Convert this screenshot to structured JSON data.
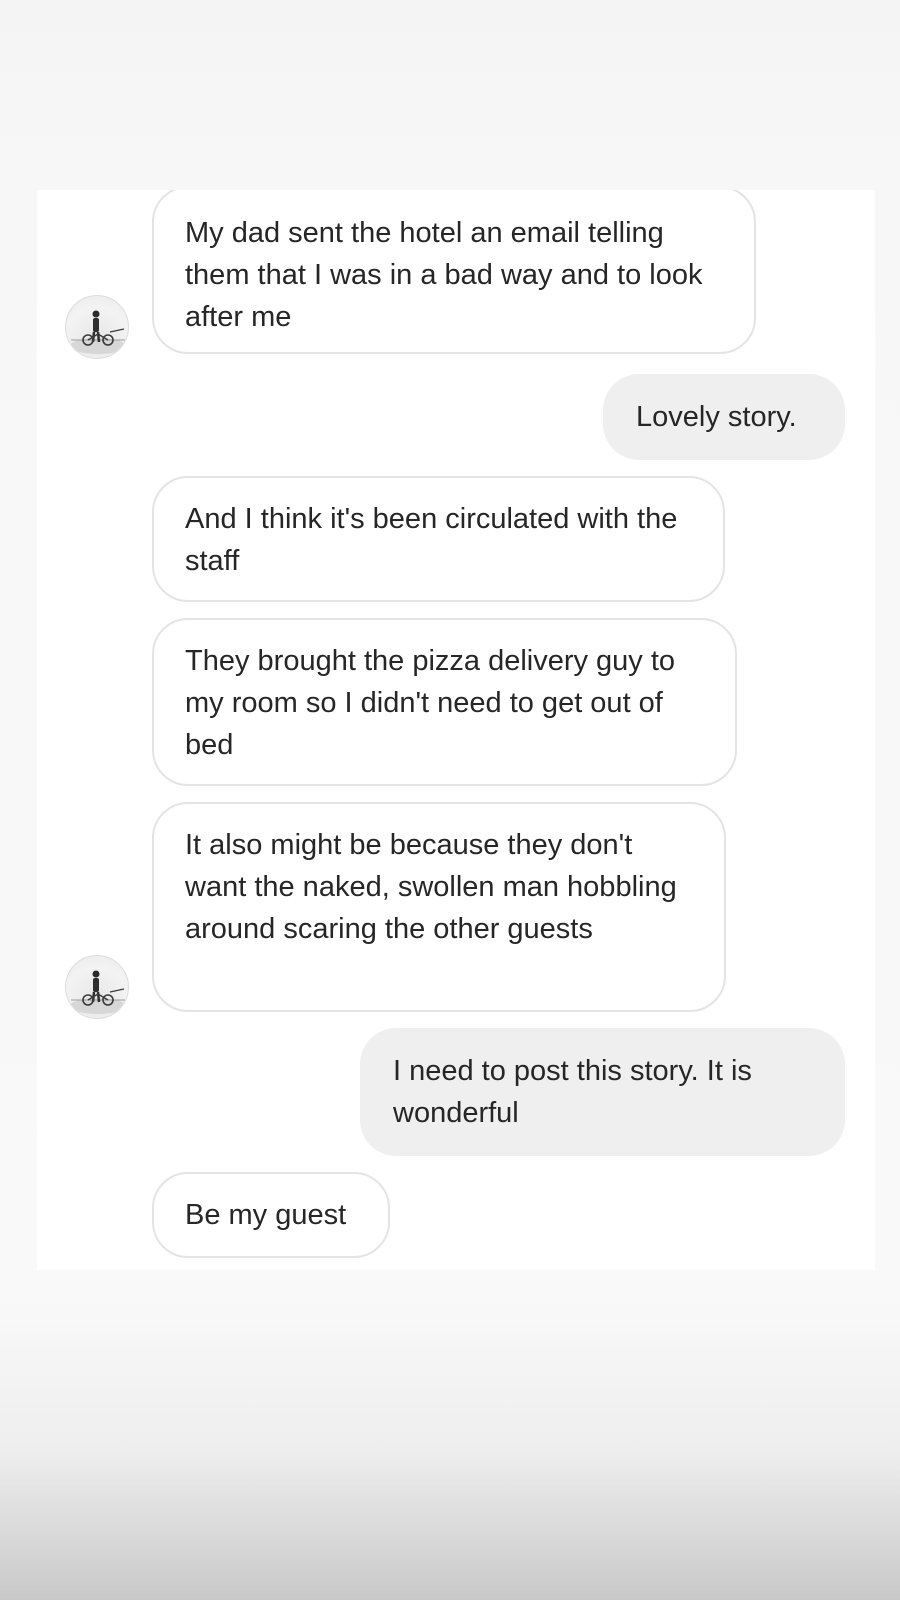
{
  "conversation": {
    "contact_avatar_icon": "profile-photo-person-with-bicycle-icon",
    "messages": [
      {
        "direction": "received",
        "text": "My dad sent the hotel an email telling them that I was in a bad way and to look after me"
      },
      {
        "direction": "sent",
        "text": "Lovely story."
      },
      {
        "direction": "received",
        "text": "And I think it's been circulated with the staff"
      },
      {
        "direction": "received",
        "text": "They brought the pizza delivery guy to my room so I didn't need to get out of bed"
      },
      {
        "direction": "received",
        "text": "It also might be because they don't want the naked, swollen man hobbling around scaring the other guests"
      },
      {
        "direction": "sent",
        "text": "I need to post this story. It is wonderful"
      },
      {
        "direction": "received",
        "text": "Be my guest"
      }
    ]
  },
  "colors": {
    "received_bubble_bg": "#ffffff",
    "received_bubble_border": "#e4e4e4",
    "sent_bubble_bg": "#efefef",
    "text": "#262626"
  }
}
